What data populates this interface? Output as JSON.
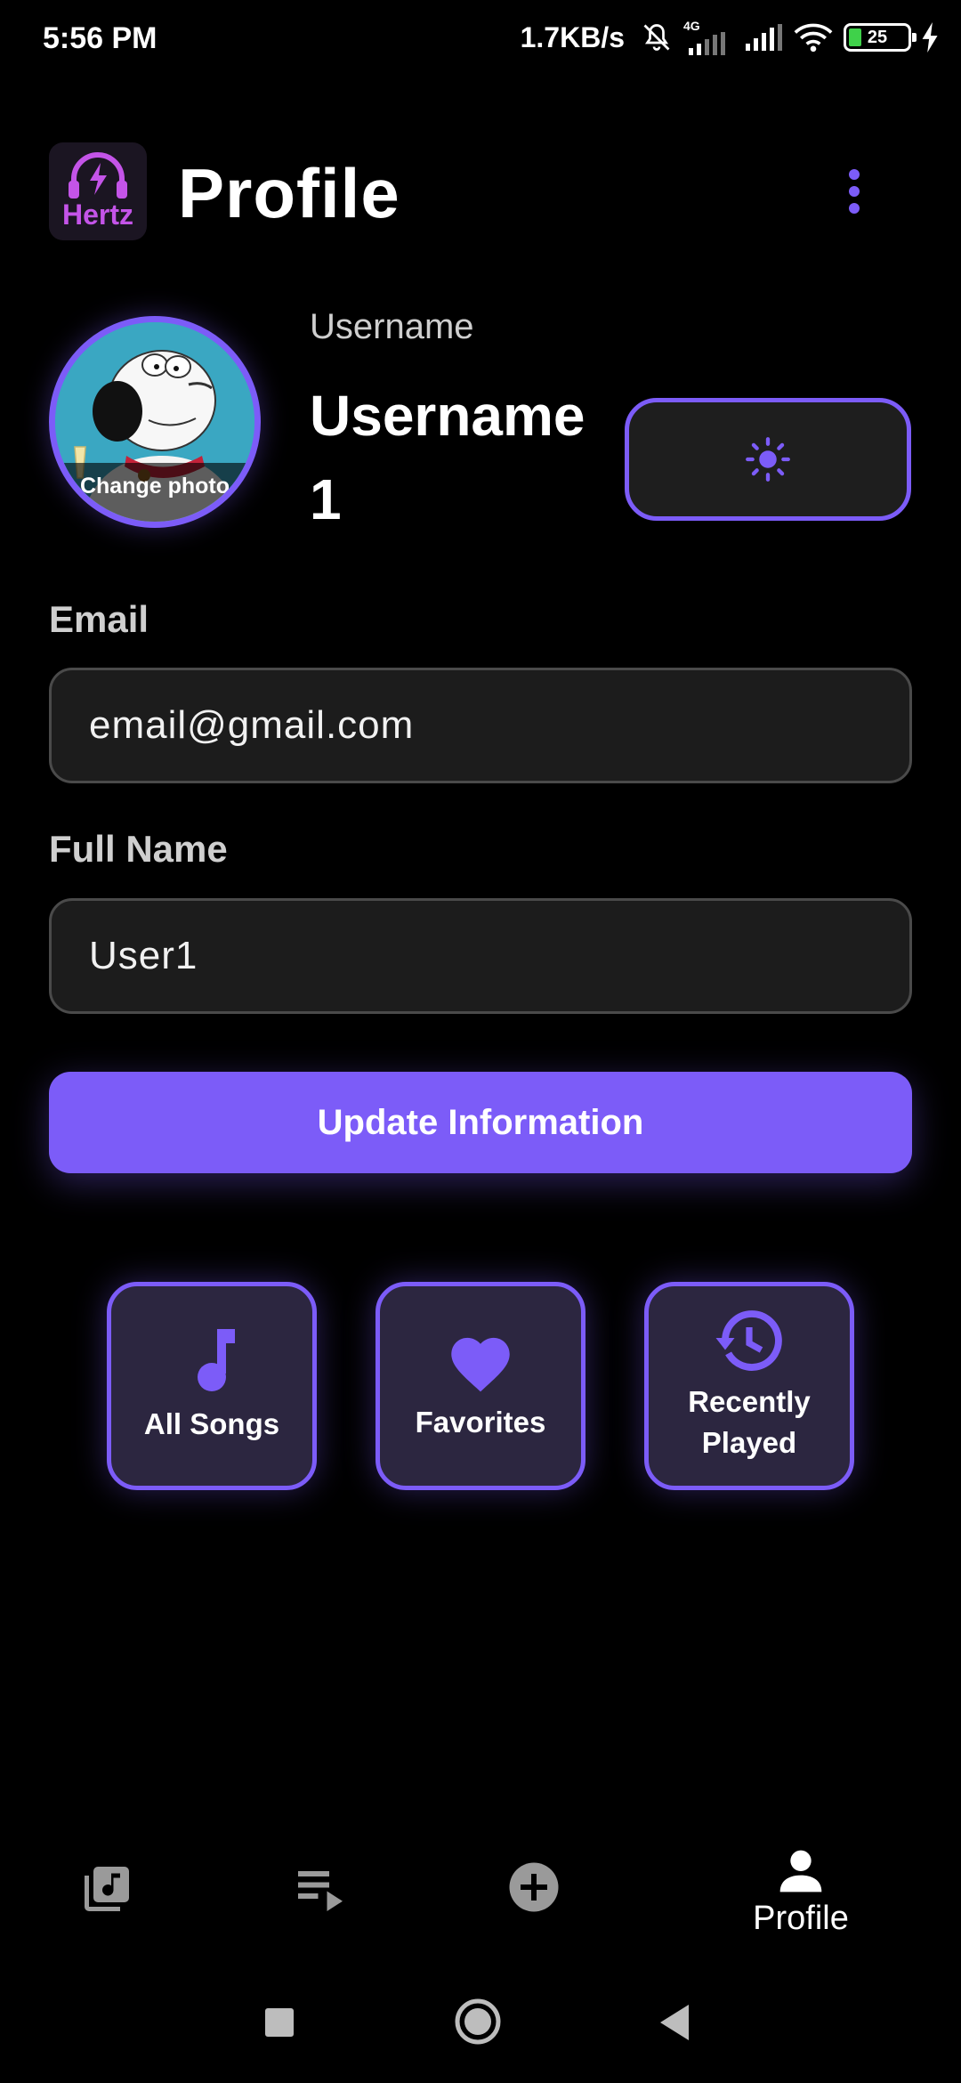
{
  "status_bar": {
    "time": "5:56 PM",
    "net_speed": "1.7KB/s",
    "network_type": "4G",
    "battery": "25",
    "icons": [
      "mute-bell-icon",
      "signal-icon",
      "signal-icon",
      "wifi-icon",
      "battery-icon",
      "charging-icon"
    ]
  },
  "header": {
    "logo_text": "Hertz",
    "title": "Profile",
    "menu_icon": "more-vert-icon"
  },
  "profile": {
    "change_photo": "Change photo",
    "username_label": "Username",
    "username": "Username 1",
    "theme_icon": "sun-icon"
  },
  "form": {
    "email_label": "Email",
    "email_value": "email@gmail.com",
    "fullname_label": "Full Name",
    "fullname_value": "User1",
    "update_button": "Update Information"
  },
  "library": {
    "tiles": [
      {
        "label": "All Songs",
        "icon": "music-note-icon"
      },
      {
        "label": "Favorites",
        "icon": "heart-icon"
      },
      {
        "label": "Recently Played",
        "icon": "history-icon"
      }
    ]
  },
  "bottom_nav": {
    "items": [
      {
        "icon": "library-music-icon",
        "label": ""
      },
      {
        "icon": "playlist-play-icon",
        "label": ""
      },
      {
        "icon": "add-circle-icon",
        "label": ""
      },
      {
        "icon": "person-icon",
        "label": "Profile"
      }
    ],
    "active": "Profile"
  },
  "colors": {
    "accent": "#7c5cf8",
    "background": "#000000",
    "field_bg": "#1c1c1c",
    "tile_bg": "#2c2640"
  }
}
